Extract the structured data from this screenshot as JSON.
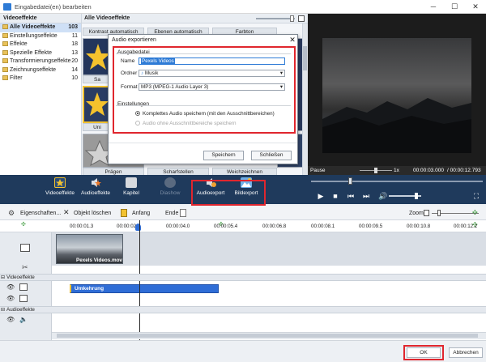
{
  "window": {
    "title": "Eingabedatei(en) bearbeiten",
    "minimize": "─",
    "maximize": "☐",
    "close": "✕"
  },
  "left_panel": {
    "header": "Videoeffekte",
    "items": [
      {
        "label": "Alle Videoeffekte",
        "count": "103"
      },
      {
        "label": "Einstellungseffekte",
        "count": "11"
      },
      {
        "label": "Effekte",
        "count": "18"
      },
      {
        "label": "Spezielle Effekte",
        "count": "13"
      },
      {
        "label": "Transformierungseffekte",
        "count": "20"
      },
      {
        "label": "Zeichnungseffekte",
        "count": "14"
      },
      {
        "label": "Filter",
        "count": "10"
      }
    ]
  },
  "gallery": {
    "header": "Alle Videoeffekte",
    "top_labels": [
      "Kontrast automatisch",
      "Ebenen automatisch",
      "Farbton"
    ],
    "left_labels": [
      "Sa",
      "Uni"
    ],
    "bottom_labels": [
      "Prägen",
      "Scharfstellen",
      "Weichzeichnen"
    ]
  },
  "preview": {
    "state": "Pause",
    "speed": "1x",
    "current_time": "00:00:03.000",
    "total_time": "/ 00:00:12.793"
  },
  "toolbar": {
    "items": [
      {
        "label": "Videoeffekte",
        "color": "#f2c230"
      },
      {
        "label": "Audioeffekte",
        "color": "#f07a2a"
      },
      {
        "label": "Kapitel",
        "color": "#d6d9de"
      },
      {
        "label": "Diashow",
        "color": "#5a6a80"
      },
      {
        "label": "Audioexport",
        "color": "#f0a030"
      },
      {
        "label": "Bildexport",
        "color": "#6db0e8"
      }
    ],
    "play_icons": [
      "▶",
      "■",
      "⏮",
      "⏭",
      "🔊",
      "⛶"
    ]
  },
  "timeline_toolbar": {
    "properties": "Eigenschaften...",
    "delete": "Objekt löschen",
    "start": "Anfang",
    "end": "Ende",
    "zoom": "Zoom:"
  },
  "ruler": {
    "ticks": [
      "00:00:01.3",
      "00:00:02.",
      "00:00:04.0",
      "00:00:05.4",
      "00:00:06.8",
      "00:00:08.1",
      "00:00:09.5",
      "00:00:10.8",
      "00:00:12.2"
    ]
  },
  "tracks": {
    "video_clip_label": "Pexels Videos.mov",
    "video_effects_label": "Videoeffekte",
    "effect_clip_label": "Umkehrung",
    "audio_effects_label": "Audioeffekte"
  },
  "dialog": {
    "title": "Audio exportieren",
    "group_output": "Ausgabedatei",
    "name_label": "Name",
    "name_value": "Pexels Videos",
    "folder_label": "Ordner",
    "folder_value": "Musik",
    "format_label": "Format",
    "format_value": "MP3 (MPEG-1 Audio Layer 3)",
    "group_settings": "Einstellungen",
    "option_full": "Komplettes Audio speichern (mit den Ausschnittbereichen)",
    "option_no_cut": "Audio ohne Ausschnittbereiche speichern",
    "save_button": "Speichern",
    "close_button": "Schließen"
  },
  "bottom": {
    "ok": "OK",
    "cancel": "Abbrechen"
  },
  "colors": {
    "accent_red": "#e0262e",
    "toolbar_bg": "#1f3a5c",
    "effect_clip": "#2f6dd6",
    "selection": "#cfe0f6"
  }
}
